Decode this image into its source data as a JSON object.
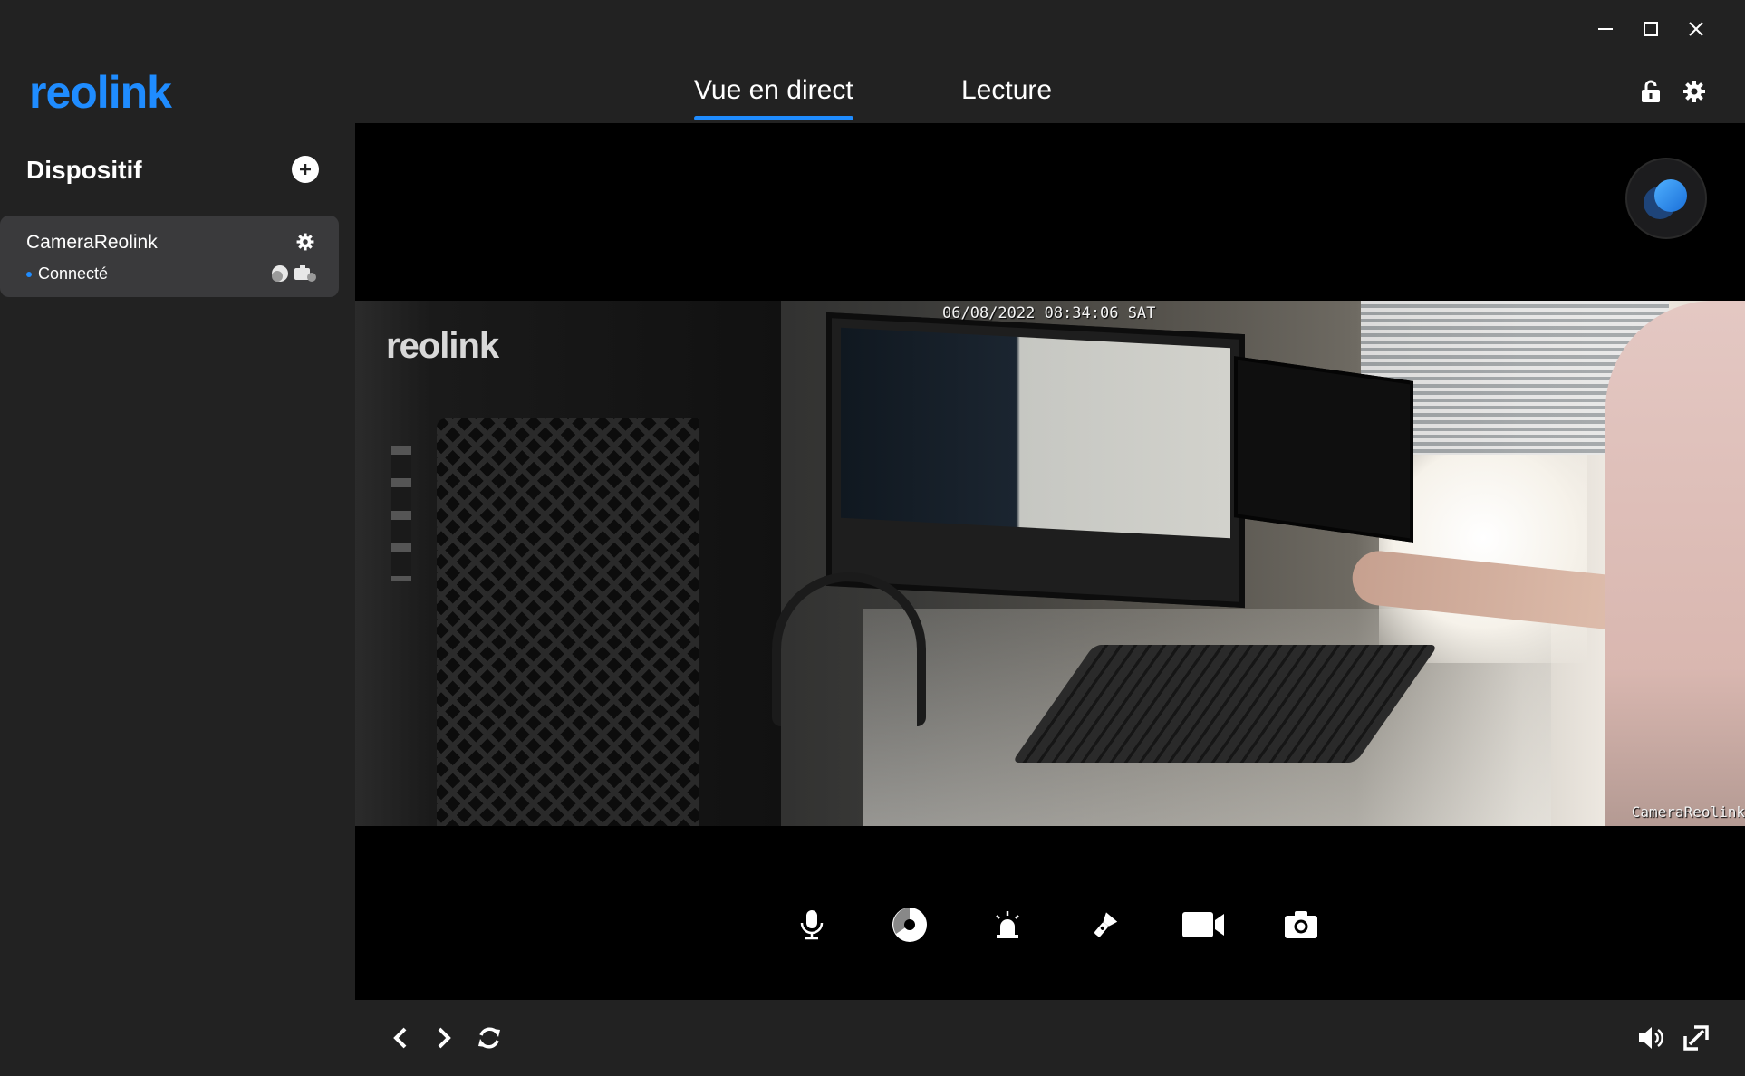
{
  "app": {
    "logo_text": "reolink",
    "brand_color": "#1f8cff",
    "window_controls": [
      "minimize-icon",
      "maximize-icon",
      "close-icon"
    ]
  },
  "tabs": [
    {
      "label": "Vue en direct",
      "active": true
    },
    {
      "label": "Lecture",
      "active": false
    }
  ],
  "header_icons": [
    "lock-icon",
    "gear-icon"
  ],
  "sidebar": {
    "title": "Dispositif",
    "devices": [
      {
        "name": "CameraReolink",
        "status": "Connecté",
        "status_color": "#1f8cff"
      }
    ]
  },
  "video": {
    "timestamp": "06/08/2022 08:34:06 SAT",
    "watermark": "reolink",
    "camera_label": "CameraReolink"
  },
  "controls": [
    "microphone-icon",
    "lens-icon",
    "siren-icon",
    "spotlight-icon",
    "record-icon",
    "snapshot-icon"
  ],
  "bottom_bar": {
    "left": [
      "chevron-left-icon",
      "chevron-right-icon",
      "refresh-icon"
    ],
    "right": [
      "volume-icon",
      "fullscreen-icon"
    ]
  }
}
